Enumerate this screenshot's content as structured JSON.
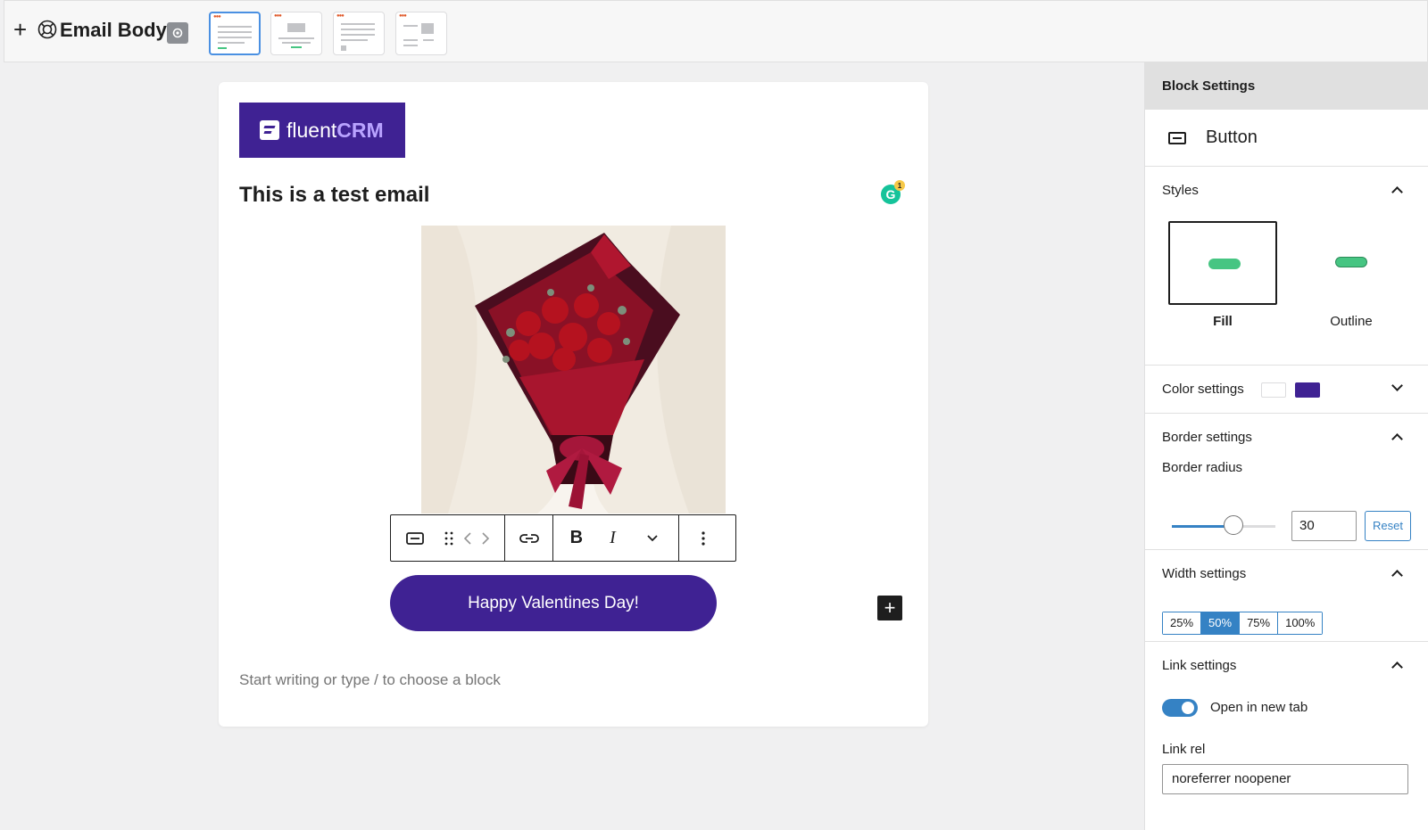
{
  "topbar": {
    "title": "Email Body"
  },
  "email": {
    "logo_text": "fluent",
    "logo_text_bold": "CRM",
    "heading": "This is a test email",
    "grammarly_count": "1",
    "grammarly_letter": "G",
    "button_label": "Happy Valentines Day!",
    "placeholder": "Start writing or type / to choose a block",
    "add_block_icon": "+"
  },
  "toolbar": {
    "icons": [
      "button-block-icon",
      "drag-handle-icon",
      "move-left-icon",
      "move-right-icon",
      "link-icon",
      "bold-icon",
      "italic-icon",
      "more-formats-chevron-icon",
      "more-options-icon"
    ],
    "bold": "B",
    "italic": "I"
  },
  "sidebar": {
    "header": "Block Settings",
    "block_name": "Button",
    "styles": {
      "title": "Styles",
      "options": [
        {
          "label": "Fill",
          "selected": true
        },
        {
          "label": "Outline",
          "selected": false
        }
      ]
    },
    "color_settings": {
      "title": "Color settings",
      "text_color": "#ffffff",
      "background_color": "#3f2293"
    },
    "border_settings": {
      "title": "Border settings",
      "radius_label": "Border radius",
      "radius_value": "30",
      "reset_label": "Reset"
    },
    "width_settings": {
      "title": "Width settings",
      "options": [
        "25%",
        "50%",
        "75%",
        "100%"
      ],
      "selected": "50%"
    },
    "link_settings": {
      "title": "Link settings",
      "new_tab_label": "Open in new tab",
      "new_tab_enabled": true,
      "rel_label": "Link rel",
      "rel_value": "noreferrer noopener"
    }
  },
  "colors": {
    "brand": "#3f2293",
    "accent": "#3582c4"
  }
}
